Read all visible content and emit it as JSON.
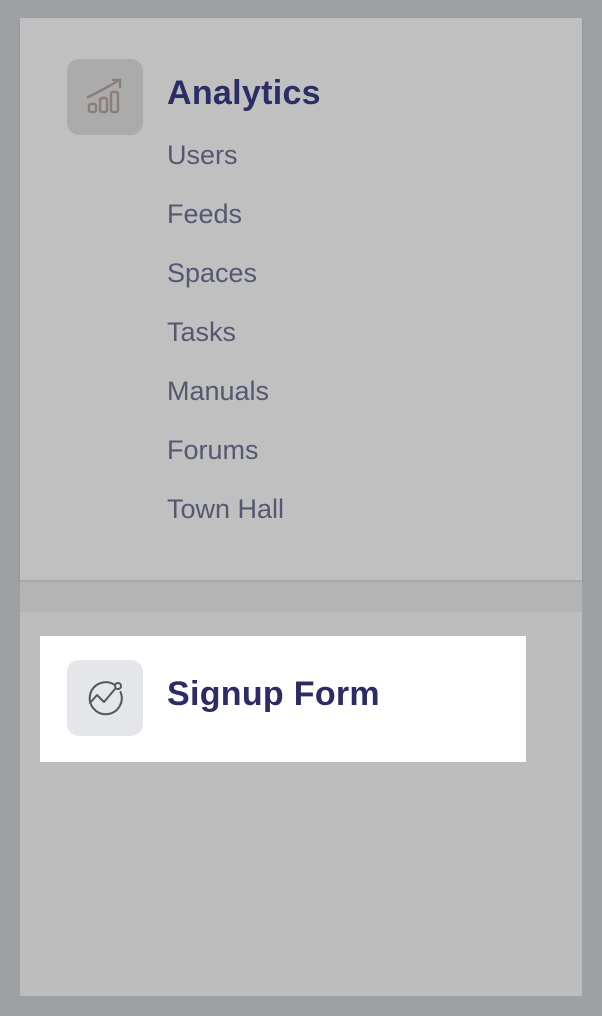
{
  "analytics": {
    "title": "Analytics",
    "icon": "bar-chart-trend-icon",
    "items": [
      {
        "label": "Users"
      },
      {
        "label": "Feeds"
      },
      {
        "label": "Spaces"
      },
      {
        "label": "Tasks"
      },
      {
        "label": "Manuals"
      },
      {
        "label": "Forums"
      },
      {
        "label": "Town Hall"
      }
    ]
  },
  "signup": {
    "title": "Signup Form",
    "icon": "trend-circle-icon"
  },
  "colors": {
    "overlay": "#9da1a4",
    "title": "#2b2e66",
    "item": "#545870",
    "highlight": "#ffffff"
  }
}
